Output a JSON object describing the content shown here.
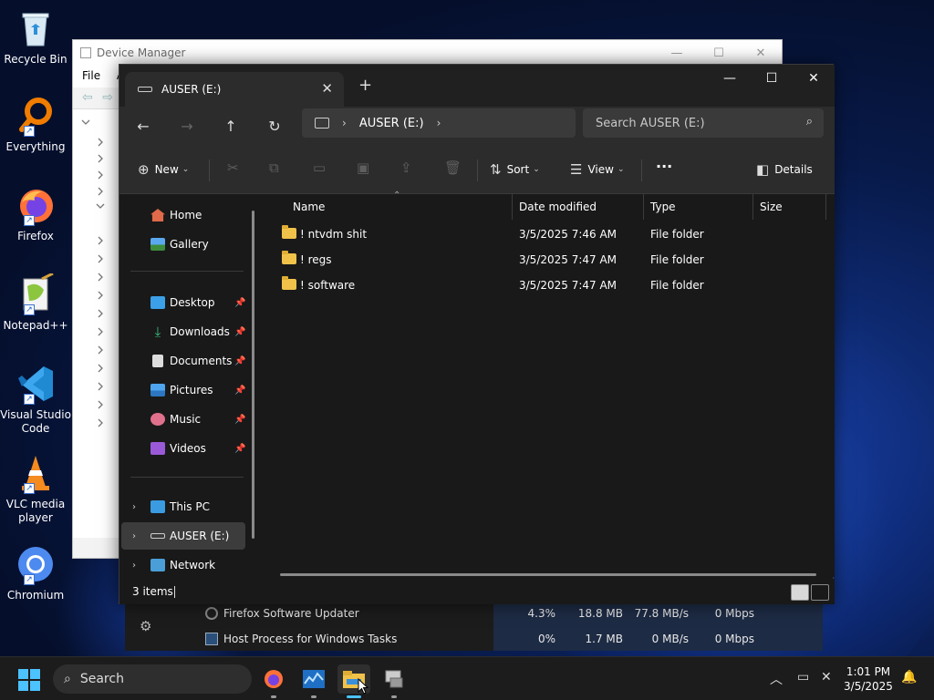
{
  "desktop": {
    "icons": [
      {
        "label": "Recycle Bin"
      },
      {
        "label": "Everything"
      },
      {
        "label": "Firefox"
      },
      {
        "label": "Notepad++"
      },
      {
        "label": "Visual Studio Code"
      },
      {
        "label": "VLC media player"
      },
      {
        "label": "Chromium"
      }
    ]
  },
  "device_manager": {
    "title": "Device Manager",
    "menu_file": "File",
    "menu_partial": "A"
  },
  "task_manager": {
    "rows": [
      {
        "name": "Firefox Software Updater",
        "cpu": "4.3%",
        "memory": "18.8 MB",
        "disk": "77.8 MB/s",
        "network": "0 Mbps"
      },
      {
        "name": "Host Process for Windows Tasks",
        "cpu": "0%",
        "memory": "1.7 MB",
        "disk": "0 MB/s",
        "network": "0 Mbps"
      }
    ]
  },
  "explorer": {
    "tab_title": "AUSER (E:)",
    "address_path": "AUSER (E:)",
    "search_placeholder": "Search AUSER (E:)",
    "toolbar": {
      "new_label": "New",
      "sort_label": "Sort",
      "view_label": "View",
      "more_label": "···",
      "details_label": "Details"
    },
    "nav": {
      "home": "Home",
      "gallery": "Gallery",
      "desktop": "Desktop",
      "downloads": "Downloads",
      "documents": "Documents",
      "pictures": "Pictures",
      "music": "Music",
      "videos": "Videos",
      "this_pc": "This PC",
      "drive": "AUSER (E:)",
      "network": "Network"
    },
    "columns": {
      "name": "Name",
      "date": "Date modified",
      "type": "Type",
      "size": "Size"
    },
    "files": [
      {
        "name": "! ntvdm shit",
        "date": "3/5/2025 7:46 AM",
        "type": "File folder"
      },
      {
        "name": "! regs",
        "date": "3/5/2025 7:47 AM",
        "type": "File folder"
      },
      {
        "name": "! software",
        "date": "3/5/2025 7:47 AM",
        "type": "File folder"
      }
    ],
    "status": "3 items"
  },
  "taskbar": {
    "search_label": "Search",
    "time": "1:01 PM",
    "date": "3/5/2025"
  },
  "colors": {
    "accent": "#4cc2ff",
    "folder": "#f0c24a"
  }
}
